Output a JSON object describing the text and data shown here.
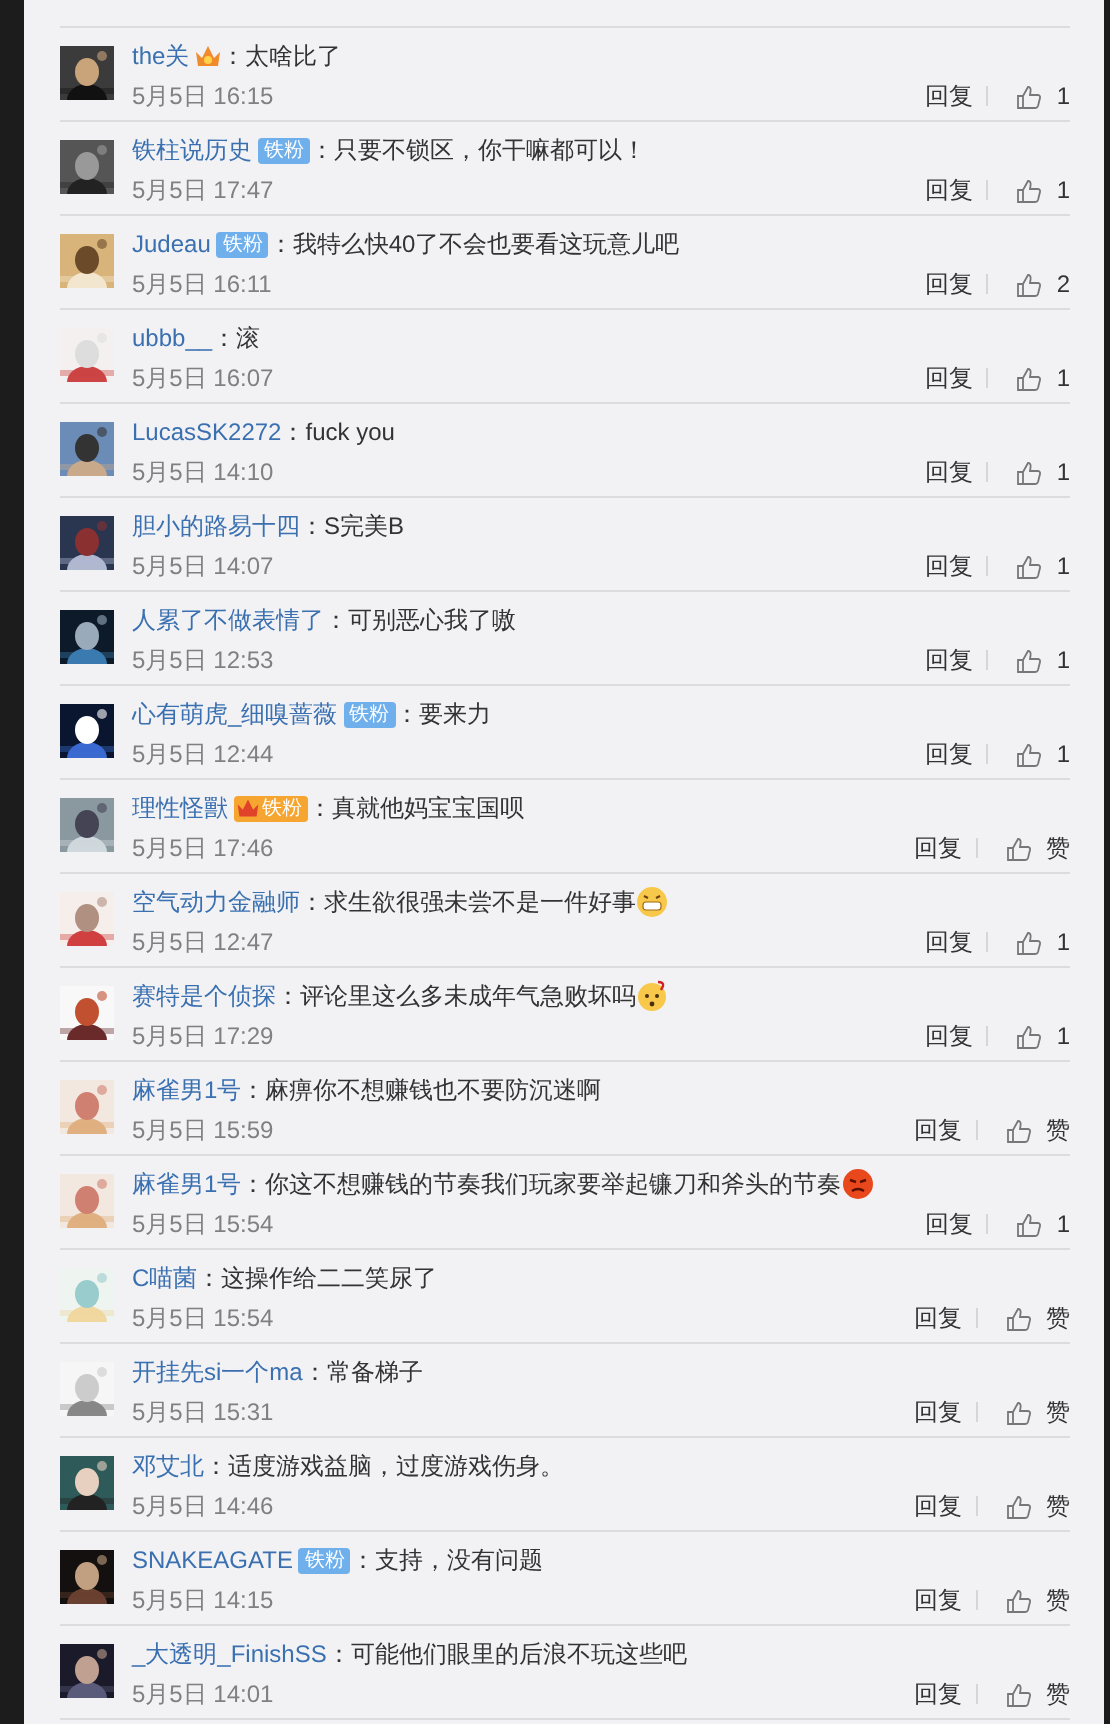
{
  "comments": [
    {
      "kind": "plain",
      "user": "the关",
      "badge": {
        "kind": "crown"
      },
      "text": "：太啥比了",
      "time": "5月5日 16:15",
      "reply": "回复",
      "likes": "1"
    },
    {
      "kind": "plain",
      "user": "铁柱说历史",
      "badge": {
        "kind": "fan",
        "label": "铁粉"
      },
      "text": "：只要不锁区，你干嘛都可以！",
      "time": "5月5日 17:47",
      "reply": "回复",
      "likes": "1"
    },
    {
      "kind": "plain",
      "user": "Judeau",
      "badge": {
        "kind": "fan",
        "label": "铁粉"
      },
      "text": "：我特么快40了不会也要看这玩意儿吧",
      "time": "5月5日 16:11",
      "reply": "回复",
      "likes": "2"
    },
    {
      "kind": "plain",
      "user": "ubbb__",
      "text": "：滚",
      "time": "5月5日 16:07",
      "reply": "回复",
      "likes": "1"
    },
    {
      "kind": "plain",
      "user": "LucasSK2272",
      "text": "：fuck you",
      "time": "5月5日 14:10",
      "reply": "回复",
      "likes": "1"
    },
    {
      "kind": "plain",
      "user": "胆小的路易十四",
      "text": "：S完美B",
      "time": "5月5日 14:07",
      "reply": "回复",
      "likes": "1"
    },
    {
      "kind": "plain",
      "user": "人累了不做表情了",
      "text": "：可别恶心我了嗷",
      "time": "5月5日 12:53",
      "reply": "回复",
      "likes": "1"
    },
    {
      "kind": "plain",
      "user": "心有萌虎_细嗅蔷薇",
      "badge": {
        "kind": "fan",
        "label": "铁粉"
      },
      "text": "：要来力",
      "time": "5月5日 12:44",
      "reply": "回复",
      "likes": "1"
    },
    {
      "kind": "plain",
      "user": "理性怪獸",
      "badge": {
        "kind": "crown-fan",
        "label": "铁粉"
      },
      "text": "：真就他妈宝宝国呗",
      "time": "5月5日 17:46",
      "reply": "回复",
      "likes": "赞"
    },
    {
      "kind": "grin",
      "user": "空气动力金融师",
      "text": "：求生欲很强未尝不是一件好事",
      "time": "5月5日 12:47",
      "reply": "回复",
      "likes": "1"
    },
    {
      "kind": "puzzled",
      "user": "赛特是个侦探",
      "text": "：评论里这么多未成年气急败坏吗",
      "time": "5月5日 17:29",
      "reply": "回复",
      "likes": "1"
    },
    {
      "kind": "plain",
      "user": "麻雀男1号",
      "text": "：麻痹你不想赚钱也不要防沉迷啊",
      "time": "5月5日 15:59",
      "reply": "回复",
      "likes": "赞"
    },
    {
      "kind": "angry",
      "user": "麻雀男1号",
      "text": "：你这不想赚钱的节奏我们玩家要举起镰刀和斧头的节奏",
      "time": "5月5日 15:54",
      "reply": "回复",
      "likes": "1"
    },
    {
      "kind": "plain",
      "user": "C喵菌",
      "text": "：这操作给二二笑尿了",
      "time": "5月5日 15:54",
      "reply": "回复",
      "likes": "赞"
    },
    {
      "kind": "plain",
      "user": "开挂先si一个ma",
      "text": "：常备梯子",
      "time": "5月5日 15:31",
      "reply": "回复",
      "likes": "赞"
    },
    {
      "kind": "plain",
      "user": "邓艾北",
      "text": "：适度游戏益脑，过度游戏伤身。",
      "time": "5月5日 14:46",
      "reply": "回复",
      "likes": "赞"
    },
    {
      "kind": "plain",
      "user": "SNAKEAGATE",
      "badge": {
        "kind": "fan",
        "label": "铁粉"
      },
      "text": "：支持，没有问题",
      "time": "5月5日 14:15",
      "reply": "回复",
      "likes": "赞"
    },
    {
      "kind": "plain",
      "user": "_大透明_FinishSS",
      "text": "：可能他们眼里的后浪不玩这些吧",
      "time": "5月5日 14:01",
      "reply": "回复",
      "likes": "赞"
    }
  ]
}
